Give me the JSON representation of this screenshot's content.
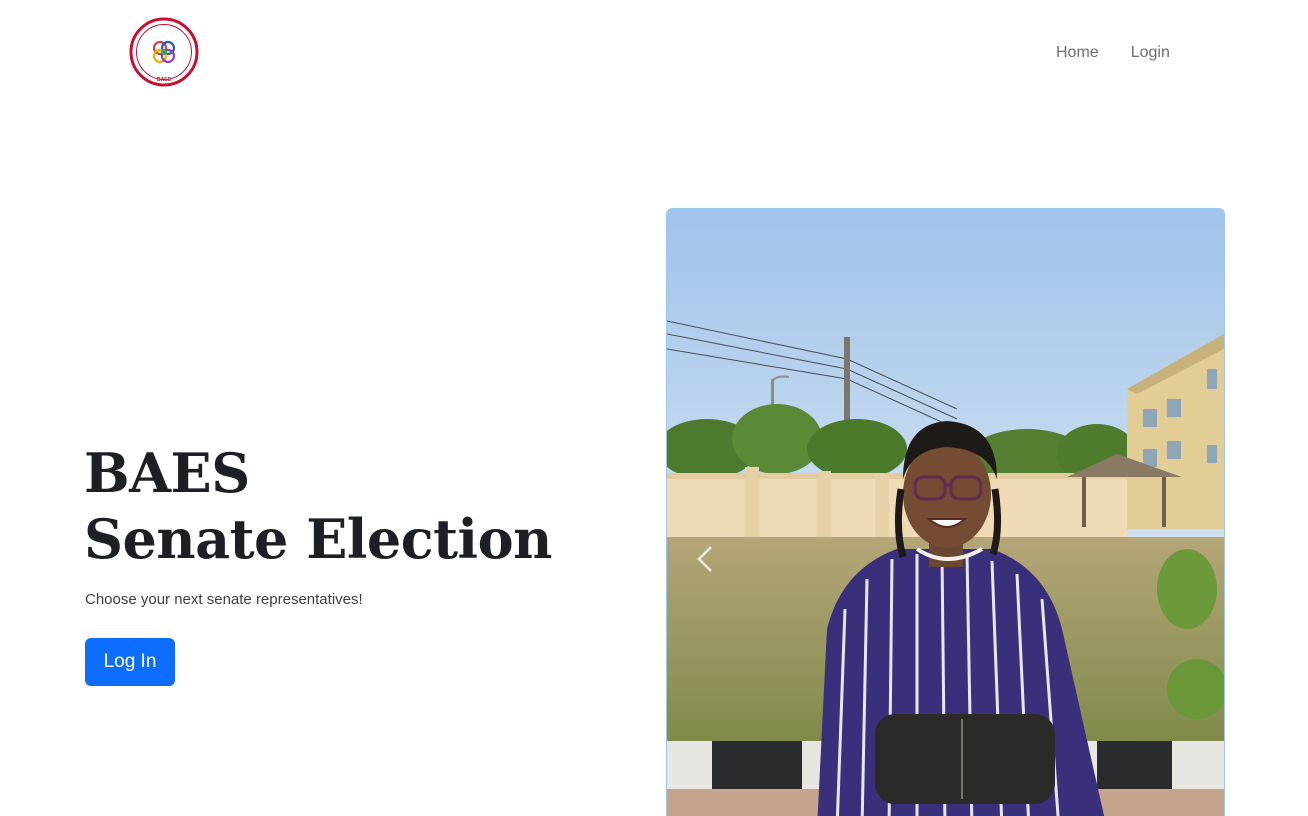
{
  "header": {
    "logo_text": "BAES",
    "nav": [
      {
        "label": "Home"
      },
      {
        "label": "Login"
      }
    ]
  },
  "hero": {
    "title_line1": "BAES",
    "title_line2": "Senate Election",
    "subtitle": "Choose your next senate representatives!",
    "cta_label": "Log In"
  },
  "carousel": {
    "prev_icon": "chevron-left-icon"
  },
  "colors": {
    "primary": "#0d6efd",
    "title": "#1c1f23",
    "nav_text": "#6b6f73",
    "logo_ring": "#c8102e"
  }
}
